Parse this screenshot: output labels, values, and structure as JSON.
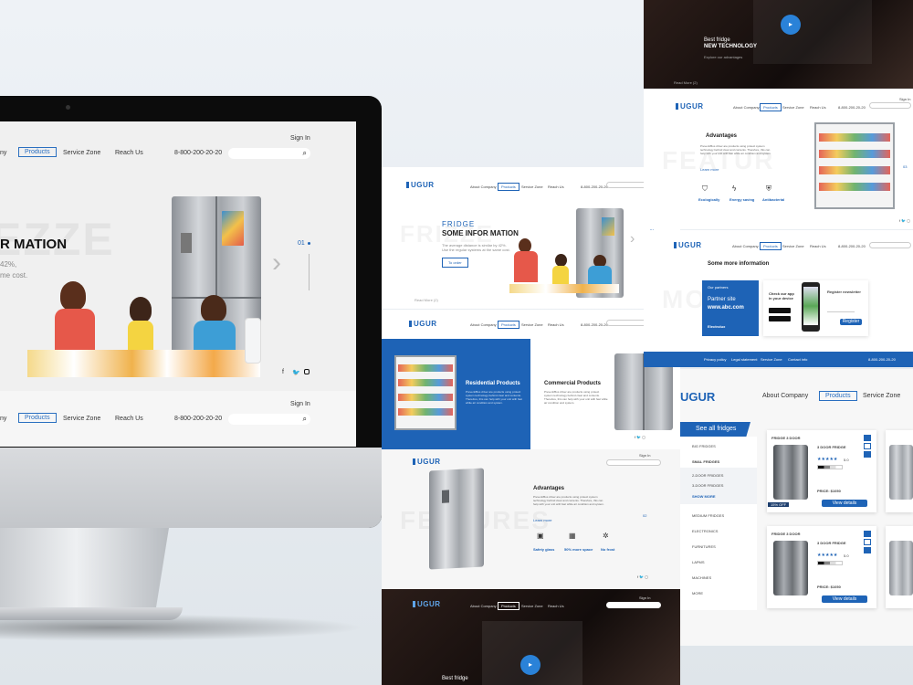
{
  "imac": {
    "sign_in": "Sign In",
    "nav": [
      "ny",
      "Products",
      "Service Zone",
      "Reach Us"
    ],
    "phone": "8-800-200-20-20",
    "hero_title": "R MATION",
    "hero_sub1": "42%,",
    "hero_sub2": "me cost.",
    "watermark": "EZZE",
    "slide_num": "01",
    "social": [
      "f",
      "twitter-icon",
      "instagram-icon"
    ],
    "footer": {
      "sign_in": "Sign In",
      "nav": [
        "ny",
        "Products",
        "Service Zone",
        "Reach Us"
      ],
      "phone": "8-800-200-20-20"
    }
  },
  "center_top": {
    "logo": "UGUR",
    "nav": [
      "About Company",
      "Products",
      "Service Zone",
      "Reach Us"
    ],
    "phone": "8-800-200-20-20",
    "kicker": "FRIDGE",
    "title": "SOME INFOR MATION",
    "desc": "The average distance is similar by 42%.",
    "desc2": "Use the regular systems at the same cost.",
    "button": "To order",
    "watermark": "FRIZZE",
    "num": "01",
    "footer_text": "Read More (2)"
  },
  "center_products": {
    "logo": "UGUR",
    "nav": [
      "About Company",
      "Products",
      "Service Zone",
      "Reach Us"
    ],
    "phone": "8-800-200-20-20",
    "residential": "Residential Products",
    "commercial": "Commercial Products",
    "body": "Prevent/Bus driver are products using protect system technology behind clear and contents. Therefore, this can help with your unit with fast while air condition and system."
  },
  "center_advantages": {
    "logo": "UGUR",
    "sign_in": "Sign In",
    "title": "Advantages",
    "learn_more": "Learn more",
    "features": [
      "Safety glass",
      "50% more space",
      "No frost"
    ],
    "watermark": "FEATURES",
    "num": "02"
  },
  "center_bottom": {
    "logo": "UGUR",
    "nav": [
      "About Company",
      "Products",
      "Service Zone",
      "Reach Us"
    ],
    "sign_in": "Sign In",
    "caption1": "Best fridge",
    "caption2": "NEW TECHNOLOGY"
  },
  "right_top": {
    "caption1": "Best fridge",
    "caption2": "NEW TECHNOLOGY",
    "caption3": "Explore our advantages",
    "read_more": "Read More (2)"
  },
  "right_adv": {
    "logo": "UGUR",
    "nav": [
      "About Company",
      "Products",
      "Service Zone",
      "Reach Us"
    ],
    "phone": "8-800-200-20-20",
    "sign_in": "Sign In",
    "title": "Advantages",
    "learn_more": "Learn more",
    "watermark": "FEATUR",
    "features": [
      "Ecologically",
      "Energy saving",
      "Antibacterial"
    ],
    "num": "03"
  },
  "right_info": {
    "logo": "UGUR",
    "nav": [
      "About Company",
      "Products",
      "Service Zone",
      "Reach Us"
    ],
    "phone": "8-800-200-20-20",
    "title": "Some more information",
    "partners": "Our partners",
    "partner_site": "Partner site",
    "site_url": "www.abc.com",
    "partner_brand": "Electrolux",
    "app_title": "Check our app in your device",
    "newsletter": "Register newsletter",
    "register_btn": "Register",
    "watermark": "MO",
    "footer_links": [
      "Privacy policy",
      "Legal statement",
      "Service Zone",
      "Contact info"
    ],
    "footer_phone": "8-800-200-20-20"
  },
  "catalog": {
    "logo": "UGUR",
    "nav": [
      "About Company",
      "Products",
      "Service Zone"
    ],
    "see_all": "See all fridges",
    "categories": [
      "BIG FRIDGES",
      "SMAL FRIDGES",
      "2-DOOR FRIDGES",
      "3-DOOR FRIDGES",
      "SHOW MORE",
      "MEDIUM FRIDGES",
      "ELECTRONICS",
      "FURNITURES",
      "LAPMS",
      "MACHINES",
      "MORE"
    ],
    "products": [
      {
        "tag": "FRIDGE 3 DOOR",
        "name": "3 DOOR FRIDGE",
        "rating": "5.0",
        "price": "PRICE: $1050",
        "btn": "View details",
        "badge": "15% OFF"
      },
      {
        "tag": "FRIDGE 3 DOOR",
        "name": "3 DOOR FRIDGE",
        "rating": "5.0",
        "price": "PRICE: $1050",
        "btn": "View details",
        "badge": ""
      }
    ]
  }
}
